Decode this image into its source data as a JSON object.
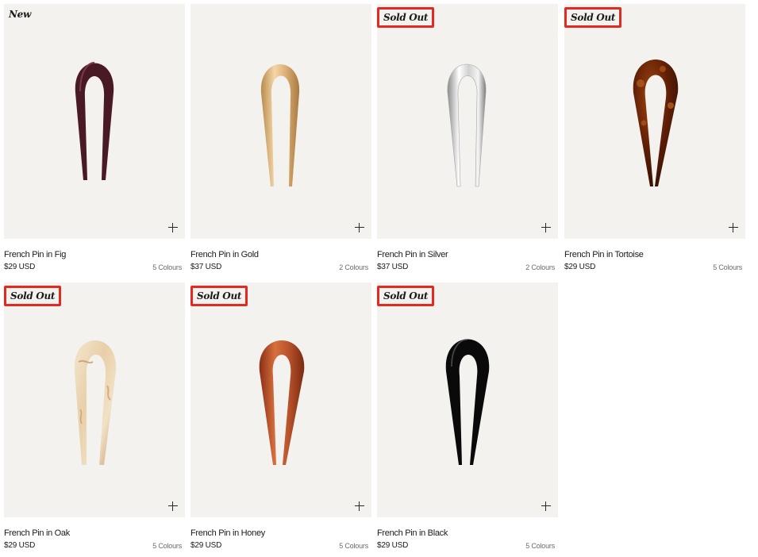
{
  "products": [
    {
      "name": "French Pin in Fig",
      "price": "$29 USD",
      "colours": "5 Colours",
      "tag": "New",
      "tag_boxed": false,
      "finish": "fig"
    },
    {
      "name": "French Pin in Gold",
      "price": "$37 USD",
      "colours": "2 Colours",
      "tag": "",
      "tag_boxed": false,
      "finish": "gold"
    },
    {
      "name": "French Pin in Silver",
      "price": "$37 USD",
      "colours": "2 Colours",
      "tag": "Sold Out",
      "tag_boxed": true,
      "finish": "silver"
    },
    {
      "name": "French Pin in Tortoise",
      "price": "$29 USD",
      "colours": "5 Colours",
      "tag": "Sold Out",
      "tag_boxed": true,
      "finish": "tortoise"
    },
    {
      "name": "French Pin in Oak",
      "price": "$29 USD",
      "colours": "5 Colours",
      "tag": "Sold Out",
      "tag_boxed": true,
      "finish": "oak"
    },
    {
      "name": "French Pin in Honey",
      "price": "$29 USD",
      "colours": "5 Colours",
      "tag": "Sold Out",
      "tag_boxed": true,
      "finish": "honey"
    },
    {
      "name": "French Pin in Black",
      "price": "$29 USD",
      "colours": "5 Colours",
      "tag": "Sold Out",
      "tag_boxed": true,
      "finish": "black"
    }
  ],
  "icons": {
    "add": "plus-icon"
  },
  "colors": {
    "card_bg": "#f3f2ef",
    "highlight": "#e32a22",
    "fig": "#4a1a24",
    "gold_a": "#f4d6a6",
    "gold_b": "#b88a4e",
    "silver_a": "#ffffff",
    "silver_b": "#8c8c8c",
    "tortoise_a": "#a34510",
    "tortoise_b": "#2e0f04",
    "oak_a": "#f3e6cc",
    "oak_b": "#c99a6e",
    "honey_a": "#d7703e",
    "honey_b": "#8a2f16",
    "black": "#0a0a0a"
  }
}
